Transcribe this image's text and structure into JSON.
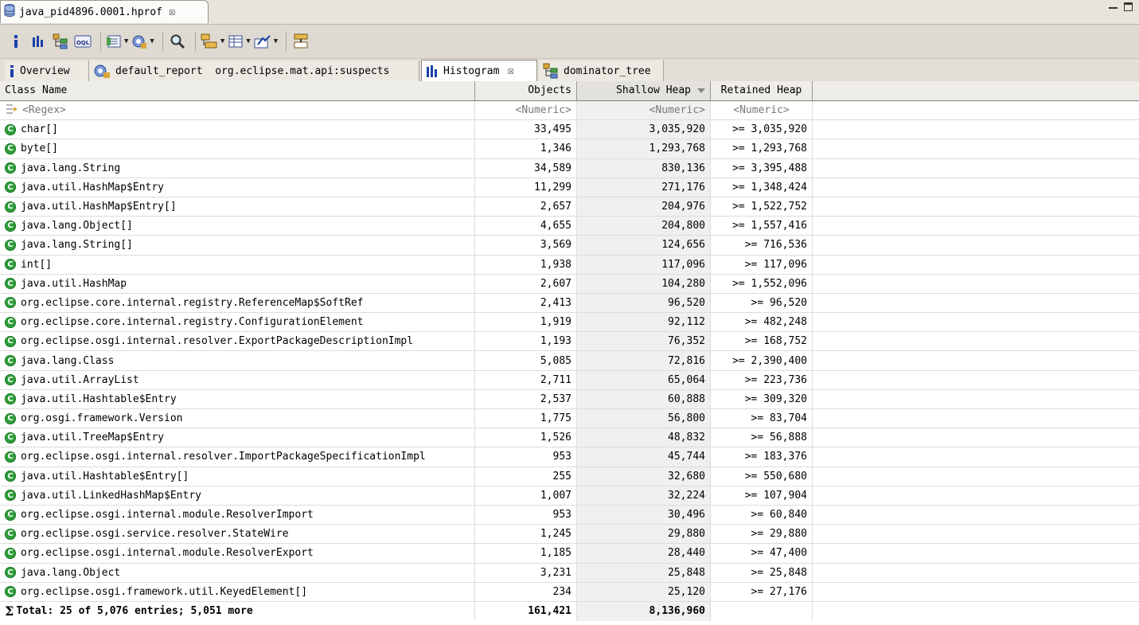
{
  "editor": {
    "tab_title": "java_pid4896.0001.hprof"
  },
  "toolbar": {
    "icons": [
      "info-icon",
      "histogram-icon",
      "dominator-tree-icon",
      "oql-icon",
      "query-browser-icon",
      "heap-dump-overview-icon",
      "search-icon",
      "group-by-icon",
      "calculate-retained-icon",
      "export-icon",
      "pin-icon"
    ]
  },
  "view_tabs": [
    {
      "label": "Overview",
      "icon": "info-icon"
    },
    {
      "label": "default_report  org.eclipse.mat.api:suspects",
      "icon": "report-icon"
    },
    {
      "label": "Histogram",
      "icon": "histogram-icon"
    },
    {
      "label": "dominator_tree",
      "icon": "tree-icon"
    }
  ],
  "table": {
    "columns": [
      "Class Name",
      "Objects",
      "Shallow Heap",
      "Retained Heap"
    ],
    "filter": {
      "class_name": "<Regex>",
      "objects": "<Numeric>",
      "shallow": "<Numeric>",
      "retained": "<Numeric>"
    },
    "rows": [
      {
        "name": "char[]",
        "objects": "33,495",
        "shallow": "3,035,920",
        "retained": ">= 3,035,920"
      },
      {
        "name": "byte[]",
        "objects": "1,346",
        "shallow": "1,293,768",
        "retained": ">= 1,293,768"
      },
      {
        "name": "java.lang.String",
        "objects": "34,589",
        "shallow": "830,136",
        "retained": ">= 3,395,488"
      },
      {
        "name": "java.util.HashMap$Entry",
        "objects": "11,299",
        "shallow": "271,176",
        "retained": ">= 1,348,424"
      },
      {
        "name": "java.util.HashMap$Entry[]",
        "objects": "2,657",
        "shallow": "204,976",
        "retained": ">= 1,522,752"
      },
      {
        "name": "java.lang.Object[]",
        "objects": "4,655",
        "shallow": "204,800",
        "retained": ">= 1,557,416"
      },
      {
        "name": "java.lang.String[]",
        "objects": "3,569",
        "shallow": "124,656",
        "retained": ">= 716,536"
      },
      {
        "name": "int[]",
        "objects": "1,938",
        "shallow": "117,096",
        "retained": ">= 117,096"
      },
      {
        "name": "java.util.HashMap",
        "objects": "2,607",
        "shallow": "104,280",
        "retained": ">= 1,552,096"
      },
      {
        "name": "org.eclipse.core.internal.registry.ReferenceMap$SoftRef",
        "objects": "2,413",
        "shallow": "96,520",
        "retained": ">= 96,520"
      },
      {
        "name": "org.eclipse.core.internal.registry.ConfigurationElement",
        "objects": "1,919",
        "shallow": "92,112",
        "retained": ">= 482,248"
      },
      {
        "name": "org.eclipse.osgi.internal.resolver.ExportPackageDescriptionImpl",
        "objects": "1,193",
        "shallow": "76,352",
        "retained": ">= 168,752"
      },
      {
        "name": "java.lang.Class",
        "objects": "5,085",
        "shallow": "72,816",
        "retained": ">= 2,390,400"
      },
      {
        "name": "java.util.ArrayList",
        "objects": "2,711",
        "shallow": "65,064",
        "retained": ">= 223,736"
      },
      {
        "name": "java.util.Hashtable$Entry",
        "objects": "2,537",
        "shallow": "60,888",
        "retained": ">= 309,320"
      },
      {
        "name": "org.osgi.framework.Version",
        "objects": "1,775",
        "shallow": "56,800",
        "retained": ">= 83,704"
      },
      {
        "name": "java.util.TreeMap$Entry",
        "objects": "1,526",
        "shallow": "48,832",
        "retained": ">= 56,888"
      },
      {
        "name": "org.eclipse.osgi.internal.resolver.ImportPackageSpecificationImpl",
        "objects": "953",
        "shallow": "45,744",
        "retained": ">= 183,376"
      },
      {
        "name": "java.util.Hashtable$Entry[]",
        "objects": "255",
        "shallow": "32,680",
        "retained": ">= 550,680"
      },
      {
        "name": "java.util.LinkedHashMap$Entry",
        "objects": "1,007",
        "shallow": "32,224",
        "retained": ">= 107,904"
      },
      {
        "name": "org.eclipse.osgi.internal.module.ResolverImport",
        "objects": "953",
        "shallow": "30,496",
        "retained": ">= 60,840"
      },
      {
        "name": "org.eclipse.osgi.service.resolver.StateWire",
        "objects": "1,245",
        "shallow": "29,880",
        "retained": ">= 29,880"
      },
      {
        "name": "org.eclipse.osgi.internal.module.ResolverExport",
        "objects": "1,185",
        "shallow": "28,440",
        "retained": ">= 47,400"
      },
      {
        "name": "java.lang.Object",
        "objects": "3,231",
        "shallow": "25,848",
        "retained": ">= 25,848"
      },
      {
        "name": "org.eclipse.osgi.framework.util.KeyedElement[]",
        "objects": "234",
        "shallow": "25,120",
        "retained": ">= 27,176"
      }
    ],
    "total": {
      "label": "Total: 25 of 5,076 entries; 5,051 more",
      "objects": "161,421",
      "shallow": "8,136,960"
    }
  }
}
